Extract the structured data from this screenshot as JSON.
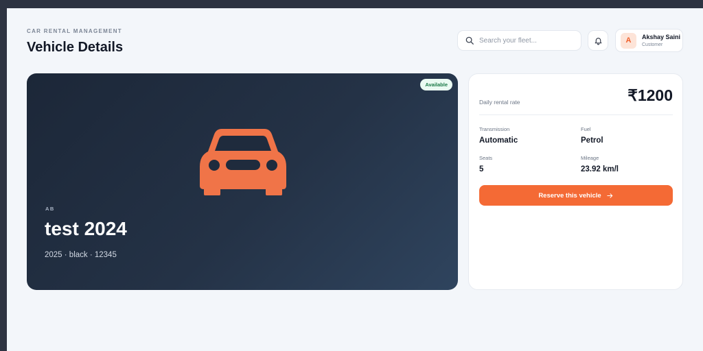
{
  "header": {
    "eyebrow": "CAR RENTAL MANAGEMENT",
    "title": "Vehicle Details"
  },
  "search": {
    "placeholder": "Search your fleet...",
    "icon": "search-icon"
  },
  "notifications": {
    "icon": "bell-icon"
  },
  "user": {
    "initial": "A",
    "name": "Akshay Saini",
    "role": "Customer"
  },
  "vehicle": {
    "status": "Available",
    "brand": "AB",
    "name": "test 2024",
    "subtitle": "2025 · black · 12345",
    "icon": "car-icon"
  },
  "pricing": {
    "label": "Daily rental rate",
    "value": "₹1200"
  },
  "specs": [
    {
      "label": "Transmission",
      "value": "Automatic"
    },
    {
      "label": "Fuel",
      "value": "Petrol"
    },
    {
      "label": "Seats",
      "value": "5"
    },
    {
      "label": "Mileage",
      "value": "23.92 km/l"
    }
  ],
  "actions": {
    "reserve_label": "Reserve this vehicle",
    "reserve_icon": "arrow-right-icon"
  },
  "colors": {
    "accent": "#f46a35",
    "hero_dark": "#1c2738",
    "status_green": "#1b7a47"
  }
}
